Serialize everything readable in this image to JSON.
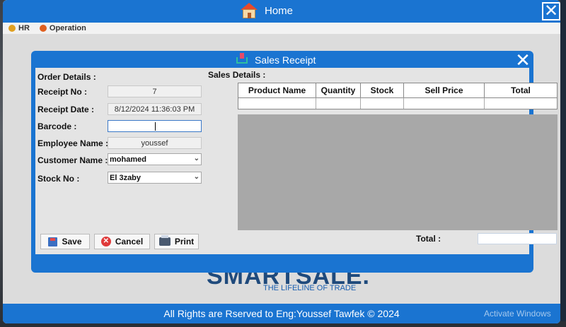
{
  "app": {
    "title": "Home",
    "close_glyph": "✕",
    "menu": [
      {
        "label": "HR",
        "icon": "hr-icon",
        "color": "#e0a020"
      },
      {
        "label": "Operation",
        "icon": "operation-icon",
        "color": "#e06020"
      }
    ],
    "logo_text": "SMARTSALE.",
    "logo_tagline": "THE LIFELINE OF TRADE",
    "footer_text": "All Rights are Rserved to Eng:Youssef Tawfek © 2024",
    "watermark": "Activate Windows"
  },
  "dialog": {
    "title": "Sales Receipt",
    "close_glyph": "✕",
    "order_details_label": "Order Details :",
    "sales_details_label": "Sales Details :",
    "fields": {
      "receipt_no": {
        "label": "Receipt No :",
        "value": "7"
      },
      "receipt_date": {
        "label": "Receipt Date :",
        "value": "8/12/2024 11:36:03 PM"
      },
      "barcode": {
        "label": "Barcode :",
        "value": ""
      },
      "employee_name": {
        "label": "Employee Name :",
        "value": "youssef"
      },
      "customer_name": {
        "label": "Customer Name :",
        "value": "mohamed"
      },
      "stock_no": {
        "label": "Stock No :",
        "value": "El 3zaby"
      }
    },
    "buttons": {
      "save": "Save",
      "cancel": "Cancel",
      "print": "Print"
    },
    "grid_columns": [
      "Product Name",
      "Quantity",
      "Stock",
      "Sell Price",
      "Total"
    ],
    "total_label": "Total :",
    "total_value": ""
  }
}
